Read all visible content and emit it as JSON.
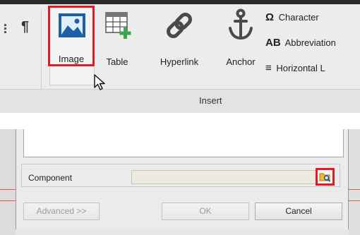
{
  "ribbon": {
    "tools": {
      "image": "Image",
      "table": "Table",
      "hyperlink": "Hyperlink",
      "anchor": "Anchor"
    },
    "small_tools": {
      "character": {
        "symbol": "Ω",
        "label": "Character"
      },
      "abbreviation": {
        "symbol": "AB",
        "label": "Abbreviation"
      },
      "horizontal": {
        "symbol": "≡",
        "label": "Horizontal L"
      }
    },
    "pilcrow": "¶",
    "group_label": "Insert"
  },
  "dialog": {
    "component_label": "Component",
    "component_value": "",
    "buttons": {
      "advanced": "Advanced >>",
      "ok": "OK",
      "cancel": "Cancel"
    }
  },
  "colors": {
    "highlight": "#e01b24",
    "ribbon_bg": "#ececec",
    "dialog_bg": "#e6e6e6"
  }
}
